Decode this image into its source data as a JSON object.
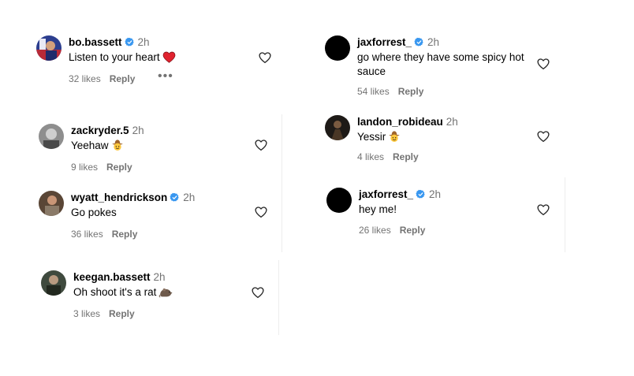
{
  "colors": {
    "verified": "#3897f0",
    "heart_red": "#e0232f",
    "secondary_text": "#737373"
  },
  "comments": [
    {
      "username": "bo.bassett",
      "verified": true,
      "time": "2h",
      "text": "Listen to your heart",
      "emoji": "red-heart",
      "likes": "32 likes",
      "reply": "Reply",
      "more": "•••"
    },
    {
      "username": "zackryder.5",
      "verified": false,
      "time": "2h",
      "text": "Yeehaw",
      "emoji": "cowboy-face",
      "likes": "9 likes",
      "reply": "Reply"
    },
    {
      "username": "wyatt_hendrickson",
      "verified": true,
      "time": "2h",
      "text": "Go pokes",
      "likes": "36 likes",
      "reply": "Reply"
    },
    {
      "username": "keegan.bassett",
      "verified": false,
      "time": "2h",
      "text": "Oh shoot it's a rat",
      "emoji": "rat",
      "likes": "3 likes",
      "reply": "Reply"
    },
    {
      "username": "jaxforrest_",
      "verified": true,
      "time": "2h",
      "text": "go where they have some spicy hot sauce",
      "likes": "54 likes",
      "reply": "Reply"
    },
    {
      "username": "landon_robideau",
      "verified": false,
      "time": "2h",
      "text": "Yessir",
      "emoji": "cowboy-face",
      "likes": "4 likes",
      "reply": "Reply"
    },
    {
      "username": "jaxforrest_",
      "verified": true,
      "time": "2h",
      "text": "hey me!",
      "likes": "26 likes",
      "reply": "Reply"
    }
  ]
}
